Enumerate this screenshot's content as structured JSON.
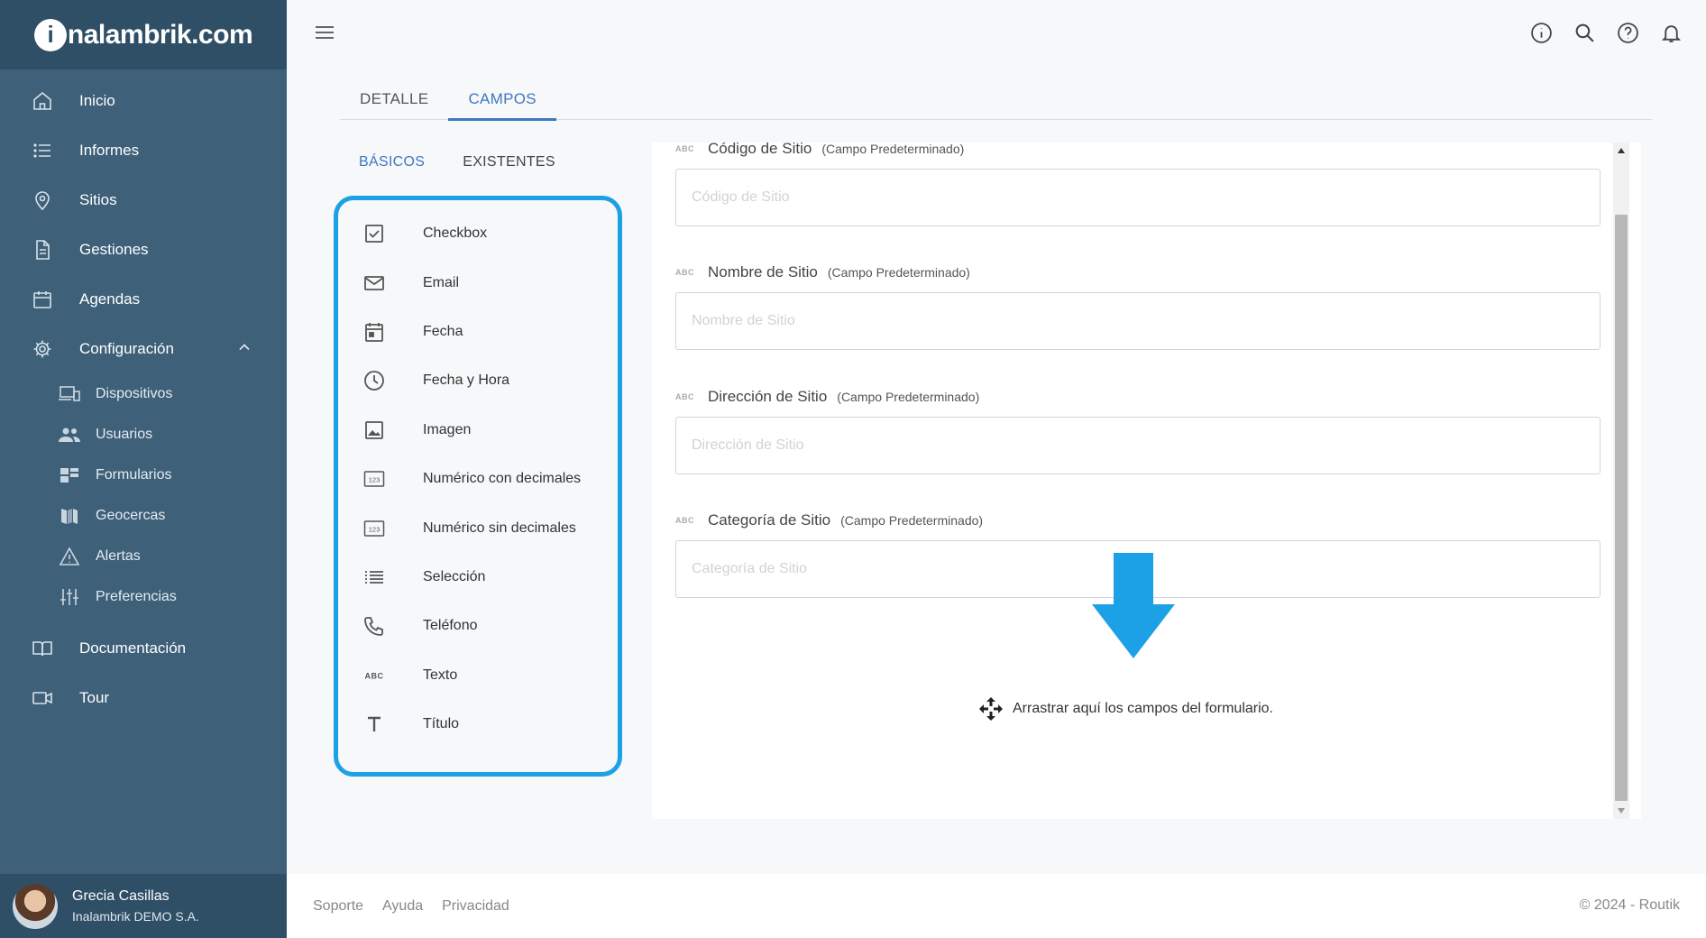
{
  "brand": {
    "logo_i": "i",
    "logo_text": "nalambrik.com"
  },
  "sidebar": {
    "items": [
      {
        "label": "Inicio",
        "icon": "home-icon"
      },
      {
        "label": "Informes",
        "icon": "list-icon"
      },
      {
        "label": "Sitios",
        "icon": "location-pin-icon"
      },
      {
        "label": "Gestiones",
        "icon": "document-icon"
      },
      {
        "label": "Agendas",
        "icon": "calendar-icon"
      },
      {
        "label": "Configuración",
        "icon": "gear-icon",
        "expanded": true
      }
    ],
    "sub_items": [
      {
        "label": "Dispositivos",
        "icon": "devices-icon"
      },
      {
        "label": "Usuarios",
        "icon": "users-icon"
      },
      {
        "label": "Formularios",
        "icon": "forms-icon"
      },
      {
        "label": "Geocercas",
        "icon": "map-icon"
      },
      {
        "label": "Alertas",
        "icon": "warning-icon"
      },
      {
        "label": "Preferencias",
        "icon": "sliders-icon"
      }
    ],
    "bottom_items": [
      {
        "label": "Documentación",
        "icon": "book-icon"
      },
      {
        "label": "Tour",
        "icon": "video-icon"
      }
    ],
    "user": {
      "name": "Grecia Casillas",
      "org": "Inalambrik DEMO S.A."
    }
  },
  "tabs": [
    {
      "label": "DETALLE",
      "active": false
    },
    {
      "label": "CAMPOS",
      "active": true
    }
  ],
  "subtabs": [
    {
      "label": "BÁSICOS",
      "active": true
    },
    {
      "label": "EXISTENTES",
      "active": false
    }
  ],
  "palette": [
    {
      "label": "Checkbox",
      "icon": "checkbox-icon"
    },
    {
      "label": "Email",
      "icon": "email-icon"
    },
    {
      "label": "Fecha",
      "icon": "date-icon"
    },
    {
      "label": "Fecha y Hora",
      "icon": "clock-icon"
    },
    {
      "label": "Imagen",
      "icon": "image-icon"
    },
    {
      "label": "Numérico con decimales",
      "icon": "numeric-icon"
    },
    {
      "label": "Numérico sin decimales",
      "icon": "numeric-icon"
    },
    {
      "label": "Selección",
      "icon": "selection-list-icon"
    },
    {
      "label": "Teléfono",
      "icon": "phone-icon"
    },
    {
      "label": "Texto",
      "icon": "text-abc-icon"
    },
    {
      "label": "Título",
      "icon": "title-icon"
    }
  ],
  "form_fields": [
    {
      "type_tag": "ABC",
      "label": "Código de Sitio",
      "tag": "(Campo Predeterminado)",
      "placeholder": "Código de Sitio"
    },
    {
      "type_tag": "ABC",
      "label": "Nombre de Sitio",
      "tag": "(Campo Predeterminado)",
      "placeholder": "Nombre de Sitio"
    },
    {
      "type_tag": "ABC",
      "label": "Dirección de Sitio",
      "tag": "(Campo Predeterminado)",
      "placeholder": "Dirección de Sitio"
    },
    {
      "type_tag": "ABC",
      "label": "Categoría de Sitio",
      "tag": "(Campo Predeterminado)",
      "placeholder": "Categoría de Sitio"
    }
  ],
  "drop_zone": {
    "text": "Arrastrar aquí los campos del formulario.",
    "icon": "move-icon"
  },
  "footer": {
    "links": [
      "Soporte",
      "Ayuda",
      "Privacidad"
    ],
    "copyright": "© 2024 - Routik"
  },
  "colors": {
    "sidebar": "#3e6079",
    "sidebar_dark": "#2f4f67",
    "accent": "#3d78c2",
    "highlight": "#1da1e6"
  }
}
